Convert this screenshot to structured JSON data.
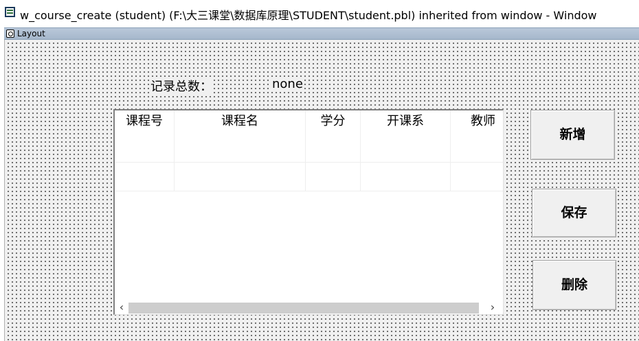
{
  "window": {
    "title": "w_course_create (student) (F:\\大三课堂\\数据库原理\\STUDENT\\student.pbl) inherited from window - Window"
  },
  "layout_bar": {
    "label": "Layout"
  },
  "record_count": {
    "label": "记录总数：",
    "value": "none"
  },
  "datawindow": {
    "columns": [
      "课程号",
      "课程名",
      "学分",
      "开课系",
      "教师"
    ],
    "rows": [
      [
        "",
        "",
        "",
        "",
        ""
      ],
      [
        "",
        "",
        "",
        "",
        ""
      ]
    ]
  },
  "buttons": {
    "add": "新增",
    "save": "保存",
    "delete": "删除"
  },
  "icons": {
    "window": "window-icon",
    "layout": "layout-icon",
    "scroll_left": "chevron-left-icon",
    "scroll_right": "chevron-right-icon"
  }
}
